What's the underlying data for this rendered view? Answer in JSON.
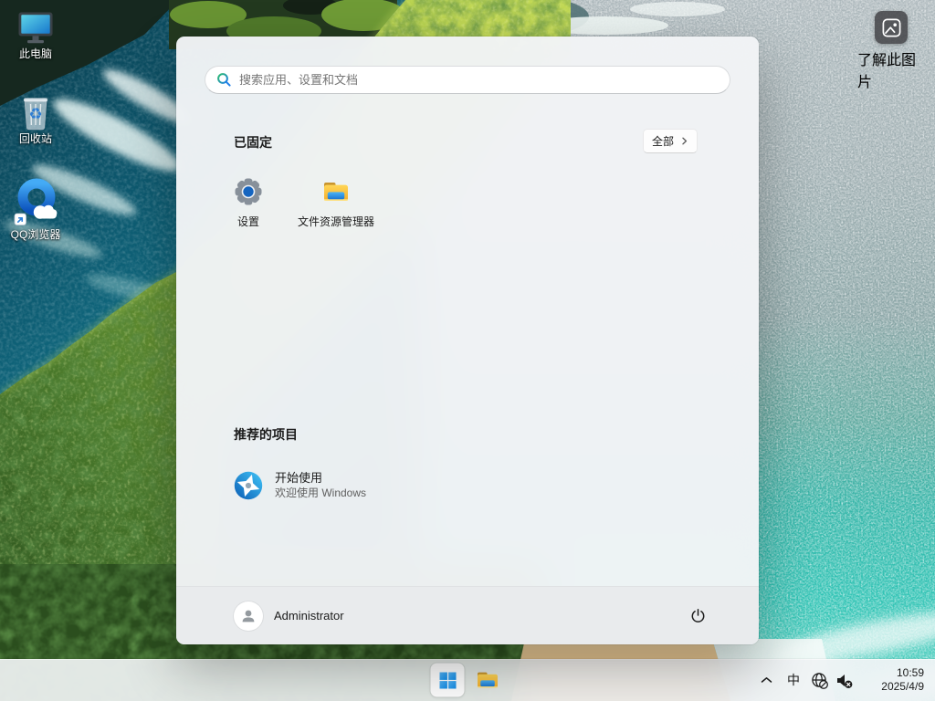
{
  "desktop": {
    "icons": [
      {
        "label": "此电脑"
      },
      {
        "label": "回收站"
      },
      {
        "label": "QQ浏览器"
      }
    ],
    "spotlight_label": "了解此图片"
  },
  "start_menu": {
    "search_placeholder": "搜索应用、设置和文档",
    "pinned_title": "已固定",
    "all_button_label": "全部",
    "apps": [
      {
        "label": "设置"
      },
      {
        "label": "文件资源管理器"
      }
    ],
    "recommended_title": "推荐的项目",
    "recommended": [
      {
        "title": "开始使用",
        "subtitle": "欢迎使用 Windows"
      }
    ],
    "user_name": "Administrator"
  },
  "taskbar": {
    "ime_label": "中",
    "clock": {
      "time": "10:59",
      "date": "2025/4/9"
    }
  },
  "colors": {
    "accent_blue": "#2f9bf3",
    "folder_yellow": "#f8b831",
    "menu_bg": "#f2f4f6"
  }
}
